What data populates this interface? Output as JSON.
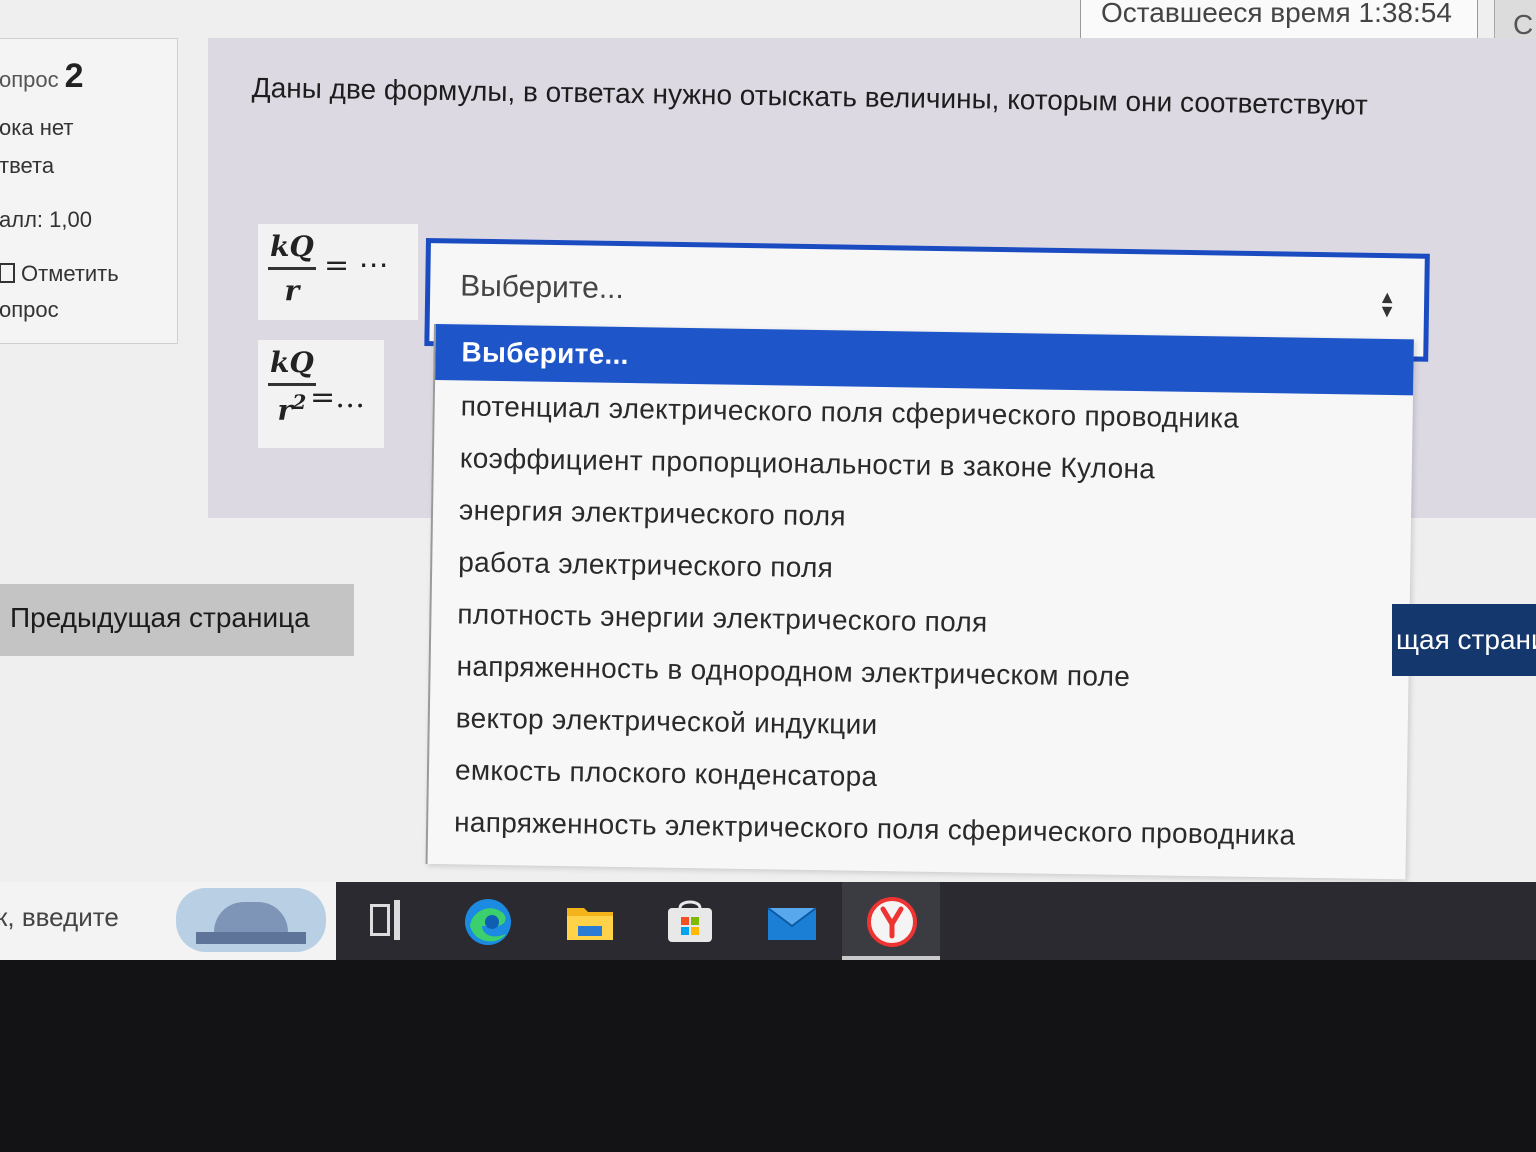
{
  "timer": {
    "label": "Оставшееся время 1:38:54",
    "extra": "С"
  },
  "question_info": {
    "prefix": "опрос",
    "number": "2",
    "status_line1": "ока нет",
    "status_line2": "твета",
    "score": "алл: 1,00",
    "flag_line1": "Отметить",
    "flag_line2": "опрос"
  },
  "question": {
    "text": "Даны две формулы, в ответах нужно отыскать величины,  которым они  соответствуют",
    "formula1": {
      "numerator": "kQ",
      "denominator": "r",
      "tail": "= ⋯"
    },
    "formula2": {
      "numerator": "kQ",
      "denominator": "r",
      "power": "2",
      "tail": "=…"
    }
  },
  "select": {
    "value": "Выберите...",
    "options": [
      "Выберите...",
      "потенциал электрического поля сферического проводника",
      "коэффициент пропорциональности в законе Кулона",
      "энергия электрического поля",
      "работа электрического поля",
      "плотность энергии электрического поля",
      "напряженность в однородном электрическом поле",
      "вектор электрической индукции",
      "емкость плоского конденсатора",
      "напряженность электрического поля сферического проводника"
    ],
    "selected_index": 0
  },
  "nav": {
    "prev_label": "Предыдущая страница",
    "next_label": "щая страни"
  },
  "taskbar": {
    "search_text": "к, введите",
    "icons": [
      "task-view-icon",
      "edge-icon",
      "file-explorer-icon",
      "store-icon",
      "mail-icon",
      "yandex-browser-icon"
    ]
  },
  "colors": {
    "accent": "#1e55c9",
    "next_button": "#14386e",
    "panel": "#dcd9e3",
    "taskbar": "#2a2a30"
  }
}
